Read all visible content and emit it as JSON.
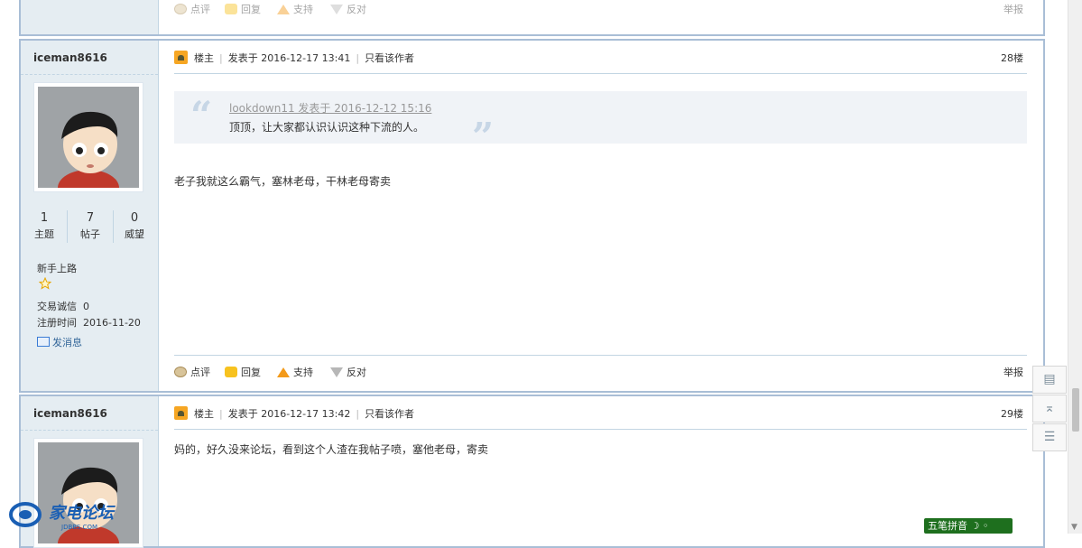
{
  "previous_post": {
    "actions": {
      "comment": "点评",
      "reply": "回复",
      "support": "支持",
      "oppose": "反对",
      "report": "举报"
    }
  },
  "posts": [
    {
      "author": "iceman8616",
      "stats": [
        {
          "value": "1",
          "label": "主题"
        },
        {
          "value": "7",
          "label": "帖子"
        },
        {
          "value": "0",
          "label": "威望"
        }
      ],
      "rank": "新手上路",
      "trust_label": "交易诚信",
      "trust_value": "0",
      "reg_label": "注册时间",
      "reg_value": "2016-11-20",
      "send_msg": "发消息",
      "host_label": "楼主",
      "posted": "发表于 2016-12-17 13:41",
      "only_author": "只看该作者",
      "floor": "28楼",
      "quote": {
        "source": "lookdown11 发表于 2016-12-12 15:16",
        "text": "顶顶，让大家都认识认识这种下流的人。"
      },
      "body": "老子我就这么霸气，塞林老母，干林老母寄卖",
      "actions": {
        "comment": "点评",
        "reply": "回复",
        "support": "支持",
        "oppose": "反对",
        "report": "举报"
      }
    },
    {
      "author": "iceman8616",
      "host_label": "楼主",
      "posted": "发表于 2016-12-17 13:42",
      "only_author": "只看该作者",
      "floor": "29楼",
      "body": "妈的，好久没来论坛，看到这个人渣在我帖子喷，塞他老母，寄卖"
    }
  ],
  "side_tools": [
    {
      "icon": "comment-icon",
      "glyph": "▤"
    },
    {
      "icon": "back-to-top-icon",
      "glyph": "⌅"
    },
    {
      "icon": "list-icon",
      "glyph": "☰"
    }
  ],
  "ime": "五笔拼音",
  "logo": {
    "text": "家电论坛",
    "sub": "JDBBS.COM"
  },
  "colors": {
    "border": "#a9bed6",
    "sidebar": "#e5edf2",
    "link": "#336699"
  }
}
